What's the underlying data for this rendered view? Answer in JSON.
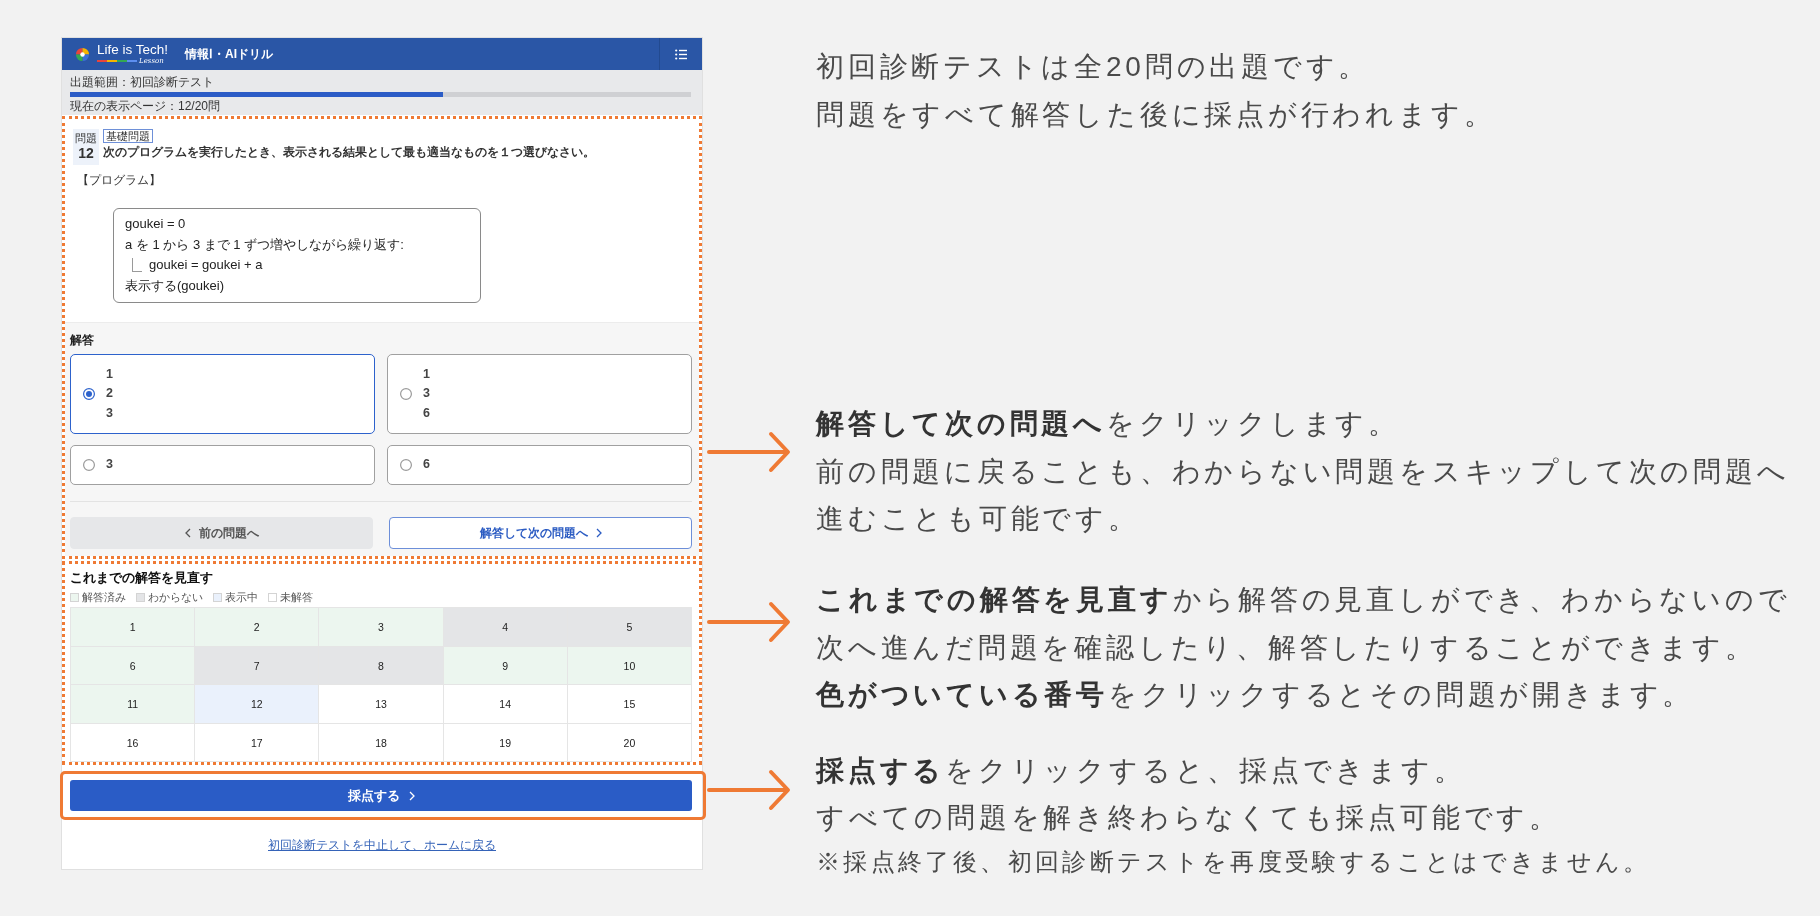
{
  "header": {
    "brand": "Life is Tech!",
    "brand_sub": "Lesson",
    "title": "情報Ⅰ・AIドリル"
  },
  "progress": {
    "scope": "出題範囲：初回診断テスト",
    "level": 0.6,
    "page": "現在の表示ページ：12/20問"
  },
  "question": {
    "label": "問題",
    "number": "12",
    "tag": "基礎問題",
    "text": "次のプログラムを実行したとき、表示される結果として最も適当なものを１つ選びなさい。",
    "program_label": "【プログラム】",
    "code": [
      {
        "text": "goukei = 0",
        "indented": false
      },
      {
        "text": "a を 1 から 3 まで 1 ずつ増やしながら繰り返す:",
        "indented": false
      },
      {
        "text": "goukei = goukei + a",
        "indented": true
      },
      {
        "text": "表示する(goukei)",
        "indented": false
      }
    ]
  },
  "answer": {
    "heading": "解答",
    "options": [
      {
        "text": "1\n2\n3",
        "selected": true
      },
      {
        "text": "1\n3\n6",
        "selected": false
      },
      {
        "text": "3",
        "selected": false
      },
      {
        "text": "6",
        "selected": false
      }
    ],
    "prev_button": "前の問題へ",
    "next_button": "解答して次の問題へ"
  },
  "review": {
    "title": "これまでの解答を見直す",
    "legend": [
      {
        "label": "解答済み",
        "color": "#ecf6ef"
      },
      {
        "label": "わからない",
        "color": "#e4e5e7"
      },
      {
        "label": "表示中",
        "color": "#eaf1fc"
      },
      {
        "label": "未解答",
        "color": "#ffffff"
      }
    ],
    "cells": [
      {
        "number": "1",
        "color": "#ecf6ef"
      },
      {
        "number": "2",
        "color": "#ecf6ef"
      },
      {
        "number": "3",
        "color": "#ecf6ef"
      },
      {
        "number": "4",
        "color": "#e4e5e7"
      },
      {
        "number": "5",
        "color": "#e4e5e7"
      },
      {
        "number": "6",
        "color": "#ecf6ef"
      },
      {
        "number": "7",
        "color": "#e4e5e7"
      },
      {
        "number": "8",
        "color": "#e4e5e7"
      },
      {
        "number": "9",
        "color": "#ecf6ef"
      },
      {
        "number": "10",
        "color": "#ecf6ef"
      },
      {
        "number": "11",
        "color": "#ecf6ef"
      },
      {
        "number": "12",
        "color": "#eaf1fc"
      },
      {
        "number": "13",
        "color": "#ffffff"
      },
      {
        "number": "14",
        "color": "#ffffff"
      },
      {
        "number": "15",
        "color": "#ffffff"
      },
      {
        "number": "16",
        "color": "#ffffff"
      },
      {
        "number": "17",
        "color": "#ffffff"
      },
      {
        "number": "18",
        "color": "#ffffff"
      },
      {
        "number": "19",
        "color": "#ffffff"
      },
      {
        "number": "20",
        "color": "#ffffff"
      }
    ]
  },
  "score_button": "採点する",
  "quit_link": "初回診断テストを中止して、ホームに戻る",
  "notes": {
    "intro": [
      "初回診断テストは全20問の出題です。",
      "問題をすべて解答した後に採点が行われます。"
    ],
    "annotations": [
      {
        "lines": [
          "**解答して次の問題へ**をクリックします。",
          "前の問題に戻ることも、わからない問題をスキップして次の問題へ",
          "進むことも可能です。"
        ]
      },
      {
        "lines": [
          "**これまでの解答を見直す**から解答の見直しができ、わからないので",
          "次へ進んだ問題を確認したり、解答したりすることができます。",
          "**色がついている番号**をクリックするとその問題が開きます。"
        ]
      },
      {
        "lines": [
          "**採点する**をクリックすると、採点できます。",
          "すべての問題を解き終わらなくても採点可能です。"
        ],
        "note": "※採点終了後、初回診断テストを再度受験することはできません。"
      }
    ]
  }
}
